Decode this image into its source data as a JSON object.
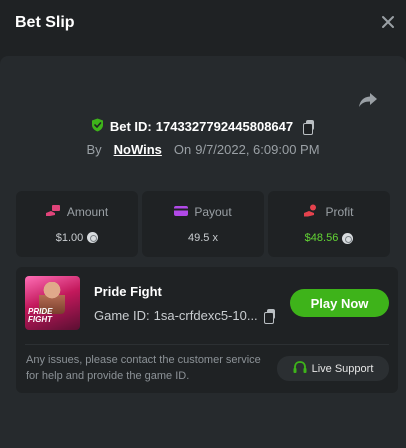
{
  "header": {
    "title": "Bet Slip"
  },
  "bet": {
    "id_label": "Bet ID:",
    "id": "1743327792445808647",
    "by_label": "By",
    "user": "NoWins",
    "on_label": "On",
    "date": "9/7/2022, 6:09:00 PM"
  },
  "stats": {
    "amount": {
      "label": "Amount",
      "value": "$1.00"
    },
    "payout": {
      "label": "Payout",
      "value": "49.5 x"
    },
    "profit": {
      "label": "Profit",
      "value": "$48.56"
    }
  },
  "game": {
    "name": "Pride Fight",
    "id_label": "Game ID:",
    "id": "1sa-crfdexc5-10...",
    "thumb_text_1": "PRIDE",
    "thumb_text_2": "FIGHT",
    "play_label": "Play Now"
  },
  "support": {
    "text": "Any issues, please contact the customer service for help and provide the game ID.",
    "button_label": "Live Support"
  },
  "colors": {
    "accent_green": "#3eb31a",
    "profit_green": "#63d535",
    "icon_pink": "#e0447a",
    "icon_purple": "#b149e8",
    "icon_red": "#e5424d"
  }
}
